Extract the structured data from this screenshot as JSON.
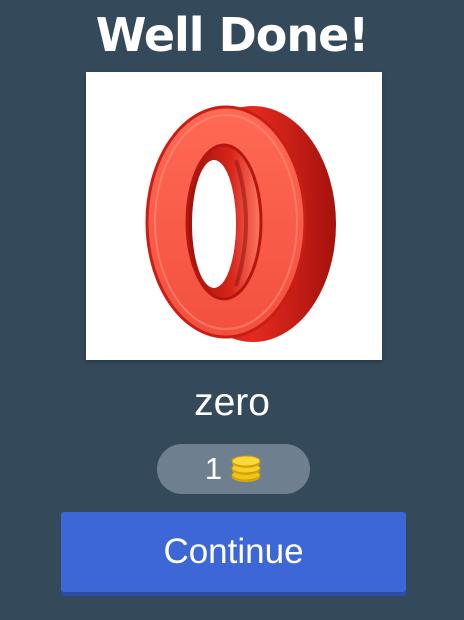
{
  "header": {
    "title": "Well Done!"
  },
  "question": {
    "image_icon": "red-3d-zero-icon",
    "answer": "zero"
  },
  "reward": {
    "coins": "1",
    "coin_icon": "gold-coins-icon"
  },
  "actions": {
    "continue_label": "Continue"
  },
  "colors": {
    "background": "#34495a",
    "button": "#3d67d6",
    "pill": "#6e8090",
    "digit_red": "#e8382c",
    "coin_gold": "#f2c418"
  }
}
